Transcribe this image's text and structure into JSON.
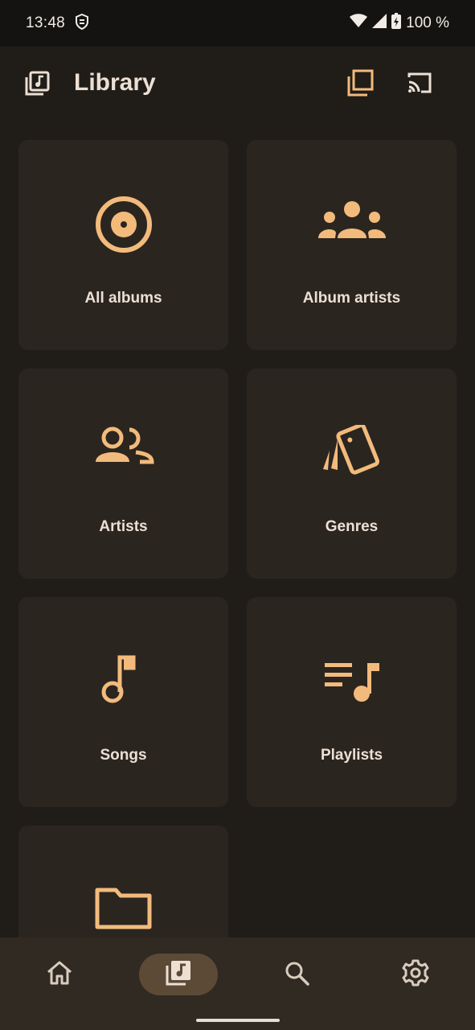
{
  "status_bar": {
    "time": "13:48",
    "battery_text": "100 %"
  },
  "app_bar": {
    "title": "Library",
    "icons": [
      "library-music-icon",
      "copy-icon",
      "cast-icon"
    ]
  },
  "tiles": [
    {
      "label": "All albums",
      "icon": "album-icon"
    },
    {
      "label": "Album artists",
      "icon": "groups-icon"
    },
    {
      "label": "Artists",
      "icon": "people-icon"
    },
    {
      "label": "Genres",
      "icon": "genres-icon"
    },
    {
      "label": "Songs",
      "icon": "music-note-icon"
    },
    {
      "label": "Playlists",
      "icon": "playlist-icon"
    },
    {
      "label": "",
      "icon": "folder-icon"
    }
  ],
  "bottom_nav": [
    {
      "icon": "home-icon",
      "active": false
    },
    {
      "icon": "library-music-icon",
      "active": true
    },
    {
      "icon": "search-icon",
      "active": false
    },
    {
      "icon": "settings-icon",
      "active": false
    }
  ],
  "colors": {
    "accent": "#f2bb7c",
    "background": "#201d19",
    "card": "#2b2520",
    "nav_background": "#302a23",
    "nav_active": "#5c4a37"
  }
}
